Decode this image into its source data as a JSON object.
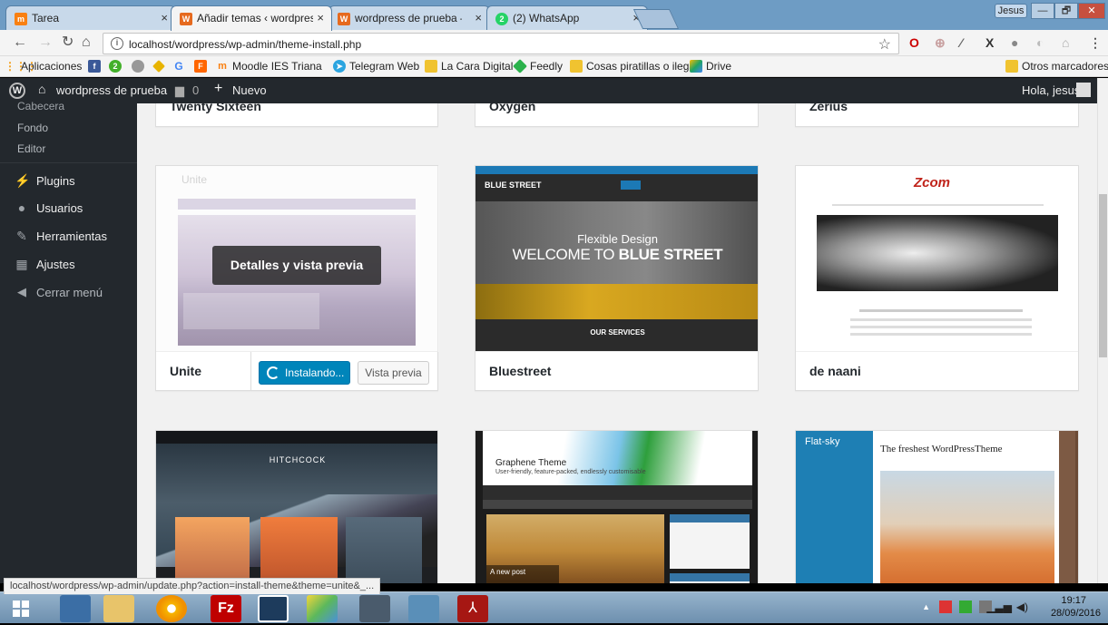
{
  "browser": {
    "tabs": [
      {
        "label": "Tarea",
        "close": "×",
        "favicon": "moodle-icon",
        "active": false
      },
      {
        "label": "Añadir temas ‹ wordpres",
        "close": "×",
        "favicon": "wordpress-orange-icon",
        "active": true
      },
      {
        "label": "wordpress de prueba – C",
        "close": "×",
        "favicon": "wordpress-orange-icon",
        "active": false
      },
      {
        "label": "(2) WhatsApp",
        "close": "×",
        "favicon": "whatsapp-icon",
        "active": false
      }
    ],
    "user_chip": "Jesus",
    "window_buttons": [
      "—",
      "🗗",
      "✕"
    ],
    "url": "localhost/wordpress/wp-admin/theme-install.php",
    "bookmarks": [
      {
        "label": "Aplicaciones",
        "color": "#f39c12"
      },
      {
        "label": "",
        "color": "#3b5998",
        "icon": "facebook-icon"
      },
      {
        "label": "",
        "color": "#43b02a",
        "icon": "whatsapp-icon"
      },
      {
        "label": "",
        "color": "#888888",
        "icon": "bookmark-icon"
      },
      {
        "label": "",
        "color": "#e8b400",
        "icon": "bookmark-icon"
      },
      {
        "label": "G",
        "color": "#4285f4",
        "icon": "google-icon"
      },
      {
        "label": "",
        "color": "#ff6600",
        "icon": "flipboard-icon"
      },
      {
        "label": "Moodle IES Triana",
        "color": "#f98012"
      },
      {
        "label": "Telegram Web",
        "color": "#2ca5e0"
      },
      {
        "label": "La Cara Digital",
        "color": "#f0c330"
      },
      {
        "label": "Feedly",
        "color": "#2bb24c"
      },
      {
        "label": "Cosas piratillas o ilega",
        "color": "#f0c330"
      },
      {
        "label": "Drive",
        "color": "#1fa463"
      }
    ],
    "other_bookmarks": "Otros marcadores",
    "status_url": "localhost/wordpress/wp-admin/update.php?action=install-theme&theme=unite&_..."
  },
  "adminbar": {
    "site": "wordpress de prueba",
    "comments": "0",
    "new": "Nuevo",
    "greeting": "Hola, jesus"
  },
  "sidebar": {
    "submenu": [
      "Cabecera",
      "Fondo",
      "Editor"
    ],
    "items": [
      {
        "label": "Plugins",
        "icon": "plug-icon"
      },
      {
        "label": "Usuarios",
        "icon": "users-icon"
      },
      {
        "label": "Herramientas",
        "icon": "wrench-icon"
      },
      {
        "label": "Ajustes",
        "icon": "settings-icon"
      },
      {
        "label": "Cerrar menú",
        "icon": "collapse-icon"
      }
    ]
  },
  "themes": {
    "top_row": [
      "Twenty Sixteen",
      "Oxygen",
      "Zerius"
    ],
    "row2": [
      {
        "name": "Unite",
        "overlay": "Detalles y vista previa",
        "install": "Instalando...",
        "preview": "Vista previa"
      },
      {
        "name": "Bluestreet",
        "hero1": "Flexible Design",
        "hero2a": "WELCOME TO ",
        "hero2b": "BLUE STREET",
        "services": "OUR SERVICES"
      },
      {
        "name": "de naani",
        "logo": "Zcom"
      }
    ],
    "row3": [
      {
        "name": "Hitchcock",
        "hero": "HITCHCOCK"
      },
      {
        "name": "Graphene",
        "title": "Graphene Theme",
        "tagline": "User-friendly, feature-packed, endlessly customisable",
        "post": "A new post"
      },
      {
        "name": "Flat-sky",
        "logo": "Flat-sky",
        "headline": "The freshest WordPressTheme"
      }
    ]
  },
  "taskbar": {
    "time": "19:17",
    "date": "28/09/2016"
  }
}
